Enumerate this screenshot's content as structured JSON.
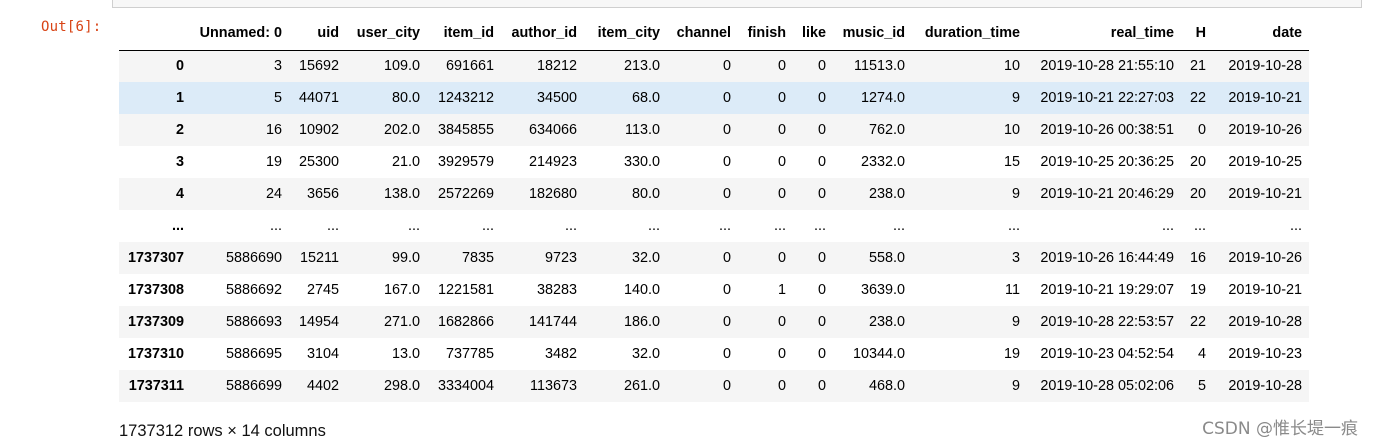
{
  "prompt": "Out[6]:",
  "columns": [
    "",
    "Unnamed: 0",
    "uid",
    "user_city",
    "item_id",
    "author_id",
    "item_city",
    "channel",
    "finish",
    "like",
    "music_id",
    "duration_time",
    "real_time",
    "H",
    "date"
  ],
  "rows": [
    {
      "index": "0",
      "cells": [
        "3",
        "15692",
        "109.0",
        "691661",
        "18212",
        "213.0",
        "0",
        "0",
        "0",
        "11513.0",
        "10",
        "2019-10-28 21:55:10",
        "21",
        "2019-10-28"
      ]
    },
    {
      "index": "1",
      "cells": [
        "5",
        "44071",
        "80.0",
        "1243212",
        "34500",
        "68.0",
        "0",
        "0",
        "0",
        "1274.0",
        "9",
        "2019-10-21 22:27:03",
        "22",
        "2019-10-21"
      ]
    },
    {
      "index": "2",
      "cells": [
        "16",
        "10902",
        "202.0",
        "3845855",
        "634066",
        "113.0",
        "0",
        "0",
        "0",
        "762.0",
        "10",
        "2019-10-26 00:38:51",
        "0",
        "2019-10-26"
      ]
    },
    {
      "index": "3",
      "cells": [
        "19",
        "25300",
        "21.0",
        "3929579",
        "214923",
        "330.0",
        "0",
        "0",
        "0",
        "2332.0",
        "15",
        "2019-10-25 20:36:25",
        "20",
        "2019-10-25"
      ]
    },
    {
      "index": "4",
      "cells": [
        "24",
        "3656",
        "138.0",
        "2572269",
        "182680",
        "80.0",
        "0",
        "0",
        "0",
        "238.0",
        "9",
        "2019-10-21 20:46:29",
        "20",
        "2019-10-21"
      ]
    },
    {
      "index": "...",
      "cells": [
        "...",
        "...",
        "...",
        "...",
        "...",
        "...",
        "...",
        "...",
        "...",
        "...",
        "...",
        "...",
        "...",
        "..."
      ]
    },
    {
      "index": "1737307",
      "cells": [
        "5886690",
        "15211",
        "99.0",
        "7835",
        "9723",
        "32.0",
        "0",
        "0",
        "0",
        "558.0",
        "3",
        "2019-10-26 16:44:49",
        "16",
        "2019-10-26"
      ]
    },
    {
      "index": "1737308",
      "cells": [
        "5886692",
        "2745",
        "167.0",
        "1221581",
        "38283",
        "140.0",
        "0",
        "1",
        "0",
        "3639.0",
        "11",
        "2019-10-21 19:29:07",
        "19",
        "2019-10-21"
      ]
    },
    {
      "index": "1737309",
      "cells": [
        "5886693",
        "14954",
        "271.0",
        "1682866",
        "141744",
        "186.0",
        "0",
        "0",
        "0",
        "238.0",
        "9",
        "2019-10-28 22:53:57",
        "22",
        "2019-10-28"
      ]
    },
    {
      "index": "1737310",
      "cells": [
        "5886695",
        "3104",
        "13.0",
        "737785",
        "3482",
        "32.0",
        "0",
        "0",
        "0",
        "10344.0",
        "19",
        "2019-10-23 04:52:54",
        "4",
        "2019-10-23"
      ]
    },
    {
      "index": "1737311",
      "cells": [
        "5886699",
        "4402",
        "298.0",
        "3334004",
        "113673",
        "261.0",
        "0",
        "0",
        "0",
        "468.0",
        "9",
        "2019-10-28 05:02:06",
        "5",
        "2019-10-28"
      ]
    }
  ],
  "hovered_row": 1,
  "summary": "1737312 rows × 14 columns",
  "watermark": "CSDN @惟长堤一痕",
  "colors": {
    "prompt": "#d84315",
    "row_odd": "#f5f5f5",
    "row_hover": "#dcebf8"
  }
}
